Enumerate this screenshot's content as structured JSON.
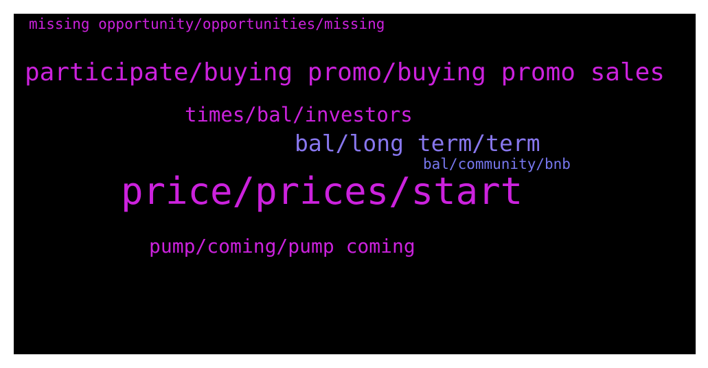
{
  "background_color": "#000000",
  "words": [
    {
      "text": "missing opportunity/opportunities/missing",
      "color": "#cc22dd"
    },
    {
      "text": "participate/buying promo/buying promo sales",
      "color": "#cc22dd"
    },
    {
      "text": "times/bal/investors",
      "color": "#cc22dd"
    },
    {
      "text": "bal/long term/term",
      "color": "#8877ee"
    },
    {
      "text": "bal/community/bnb",
      "color": "#7777ee"
    },
    {
      "text": "price/prices/start",
      "color": "#cc22dd"
    },
    {
      "text": "pump/coming/pump coming",
      "color": "#cc22dd"
    }
  ]
}
